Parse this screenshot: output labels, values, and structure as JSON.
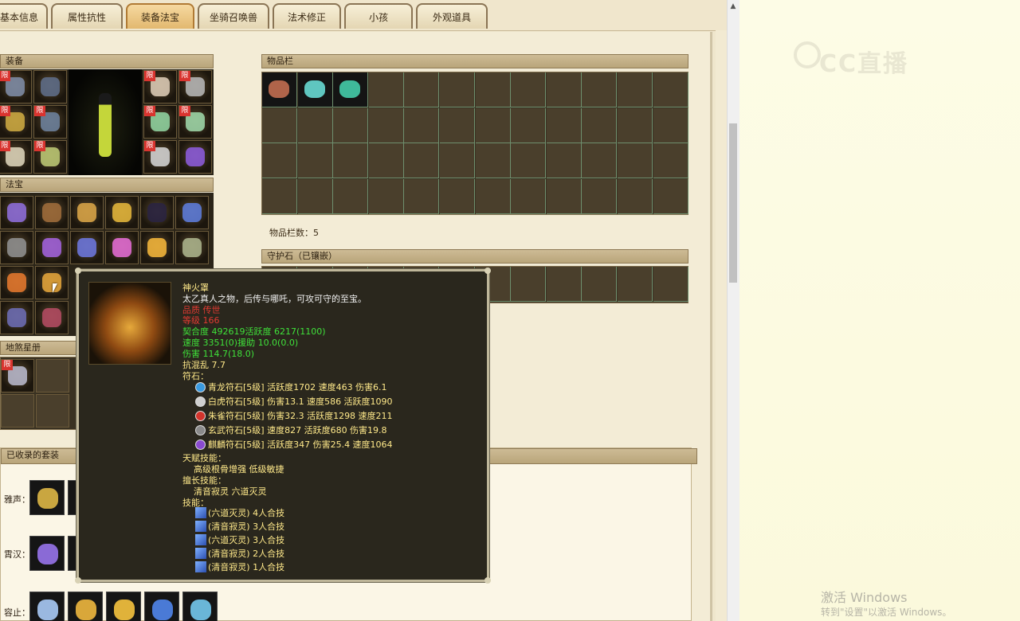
{
  "tabs": [
    {
      "label": "基本信息",
      "active": false
    },
    {
      "label": "属性抗性",
      "active": false
    },
    {
      "label": "装备法宝",
      "active": true
    },
    {
      "label": "坐骑召唤兽",
      "active": false
    },
    {
      "label": "法术修正",
      "active": false
    },
    {
      "label": "小孩",
      "active": false
    },
    {
      "label": "外观道具",
      "active": false
    }
  ],
  "equipment": {
    "title": "装备",
    "limit_badge": "限"
  },
  "treasures": {
    "title": "法宝"
  },
  "star_book": {
    "title": "地煞星册"
  },
  "inventory": {
    "title": "物品栏",
    "count_label": "物品栏数：5"
  },
  "guard_stone": {
    "title": "守护石（已镶嵌）"
  },
  "suits": {
    "title": "已收录的套装",
    "rows": [
      {
        "label": "雅声："
      },
      {
        "label": "霄汉："
      },
      {
        "label": "容止："
      }
    ]
  },
  "tooltip": {
    "name": "神火罩",
    "desc": "太乙真人之物，后传与哪吒，可攻可守的至宝。",
    "quality": "品质  传世",
    "level": "等级  166",
    "line1": "契合度     492619活跃度   6217(1100)",
    "line2": "速度      3351(0)援助      10.0(0.0)",
    "line3": "伤害    114.7(18.0)",
    "line4": "抗混乱 7.7",
    "runes_label": "符石：",
    "runes": [
      {
        "text": "青龙符石[5级] 活跃度1702 速度463 伤害6.1",
        "color": "#3a9ae0"
      },
      {
        "text": "白虎符石[5级] 伤害13.1 速度586 活跃度1090",
        "color": "#cfcfcf"
      },
      {
        "text": "朱雀符石[5级] 伤害32.3 活跃度1298 速度211",
        "color": "#d3342c"
      },
      {
        "text": "玄武符石[5级] 速度827 活跃度680 伤害19.8",
        "color": "#8a8a8a"
      },
      {
        "text": "麒麟符石[5级] 活跃度347 伤害25.4 速度1064",
        "color": "#8a4ad0"
      }
    ],
    "talent_label": "天赋技能：",
    "talent_value": "高级根骨增强     低级敏捷",
    "specialty_label": "擅长技能：",
    "specialty_value": "清音寂灵     六道灭灵",
    "skills_label": "技能：",
    "skills": [
      "(六道灭灵) 4人合技",
      "(清音寂灵) 3人合技",
      "(六道灭灵) 3人合技",
      "(清音寂灵) 2人合技",
      "(清音寂灵) 1人合技"
    ]
  },
  "watermark": {
    "brand": "CC直播"
  },
  "windows": {
    "activate_title": "激活 Windows",
    "activate_hint": "转到\"设置\"以激活 Windows。"
  },
  "colors": {
    "tab_active": "#e2b86f",
    "panel_bg": "#f3ecd6",
    "tooltip_bg": "#2a271d",
    "name_yellow": "#ffe98a",
    "stat_green": "#3fe23a",
    "quality_red": "#e23a32"
  }
}
